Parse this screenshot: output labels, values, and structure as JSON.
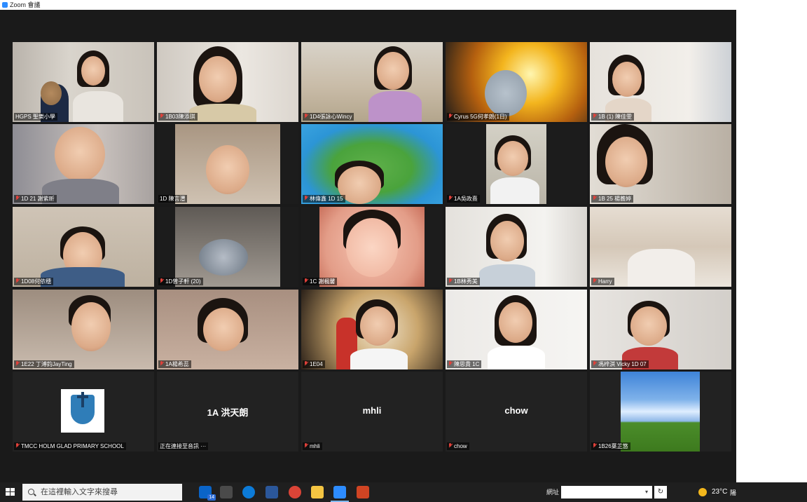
{
  "window": {
    "title": "Zoom 會議"
  },
  "participants": [
    {
      "name": "HGPS 聖樂小學",
      "muted": false,
      "active_speaker": true,
      "kind": "video"
    },
    {
      "name": "1B03陳添琪",
      "muted": true,
      "kind": "video"
    },
    {
      "name": "1D4張詠心Wincy",
      "muted": true,
      "kind": "video"
    },
    {
      "name": "Cyrus 5G何孝朗(1日)",
      "muted": true,
      "kind": "video"
    },
    {
      "name": "1B (1) 陳佳雯",
      "muted": true,
      "kind": "video"
    },
    {
      "name": "1D 21 謝紫昕",
      "muted": true,
      "kind": "video"
    },
    {
      "name": "1D 陳言灃",
      "muted": false,
      "kind": "video"
    },
    {
      "name": "林偉鑫 1D 15",
      "muted": true,
      "kind": "video"
    },
    {
      "name": "1A吳政熹",
      "muted": true,
      "kind": "video"
    },
    {
      "name": "1B 25 楊蕎婷",
      "muted": true,
      "kind": "video"
    },
    {
      "name": "1D08何依穗",
      "muted": true,
      "kind": "video"
    },
    {
      "name": "1D曾子軒 (20)",
      "muted": true,
      "kind": "video"
    },
    {
      "name": "1C 謝楓馨",
      "muted": true,
      "kind": "video"
    },
    {
      "name": "1B林秀美",
      "muted": true,
      "kind": "video"
    },
    {
      "name": "Harry",
      "muted": true,
      "kind": "video"
    },
    {
      "name": "1E22 丁溥鈞JayTing",
      "muted": true,
      "kind": "video"
    },
    {
      "name": "1A楊希蕊",
      "muted": true,
      "kind": "video"
    },
    {
      "name": "1E04",
      "muted": true,
      "kind": "video"
    },
    {
      "name": "陳思貴 1C",
      "muted": true,
      "kind": "video"
    },
    {
      "name": "馮梓淇 Vicky 1D 07",
      "muted": true,
      "kind": "video"
    },
    {
      "name": "TMCC HOLM GLAD PRIMARY SCHOOL",
      "muted": true,
      "kind": "logo"
    },
    {
      "name": "正在連接至音訊 ···",
      "display_name": "1A 洪天朗",
      "muted": false,
      "kind": "name"
    },
    {
      "name": "mhli",
      "display_name": "mhli",
      "muted": true,
      "kind": "name"
    },
    {
      "name": "chow",
      "display_name": "chow",
      "muted": true,
      "kind": "name"
    },
    {
      "name": "1B26葉芷悠",
      "muted": true,
      "kind": "landscape"
    }
  ],
  "taskbar": {
    "search_placeholder": "在這裡輸入文字來搜尋",
    "address_label": "網址",
    "temperature": "23°C",
    "more_text": "陽",
    "mail_badge": "14",
    "apps": [
      "task-view",
      "mail",
      "store",
      "edge",
      "word",
      "chrome",
      "file-explorer",
      "zoom",
      "powerpoint"
    ],
    "colors": {
      "word": "#2b579a",
      "chrome": "#db4437",
      "edge": "#0c7bd8",
      "zoom": "#2d8cff",
      "powerpoint": "#d04423",
      "explorer": "#f4c542",
      "store": "#3a3a3a",
      "mail": "#0a64c8"
    }
  }
}
